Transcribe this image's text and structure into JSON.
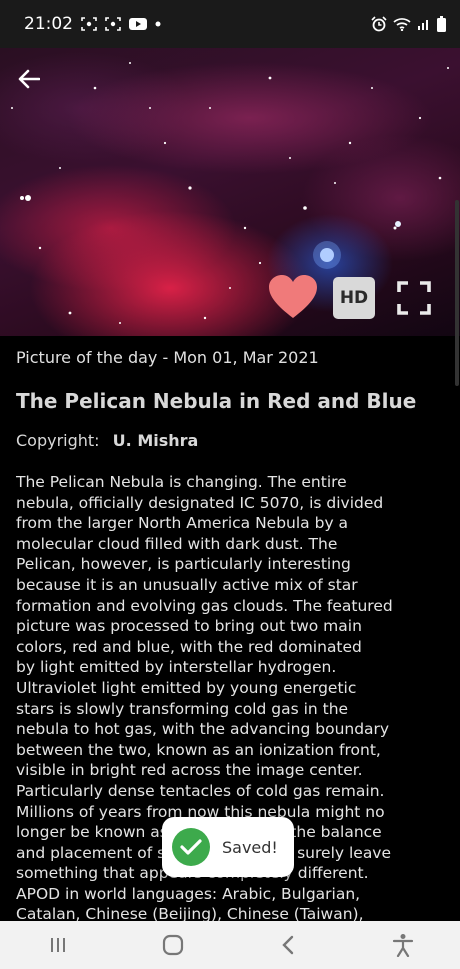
{
  "status_bar": {
    "time": "21:02",
    "notification_icons": [
      "screenshot-icon",
      "screenshot-icon",
      "youtube-icon",
      "dot-icon"
    ],
    "system_icons": [
      "alarm-icon",
      "wifi-icon",
      "signal-icon",
      "battery-icon"
    ]
  },
  "header": {
    "back_icon": "back-arrow-icon"
  },
  "image_actions": {
    "favorite_icon": "heart-icon",
    "favorite_color": "#f07a7a",
    "hd_label": "HD",
    "fullscreen_icon": "fullscreen-icon"
  },
  "apod": {
    "date_line": "Picture of the day - Mon 01, Mar 2021",
    "title": "The Pelican Nebula in Red and Blue",
    "copyright_label": "Copyright:",
    "copyright_name": "U. Mishra",
    "explanation": "The Pelican Nebula is changing.   The entire\nnebula, officially designated IC 5070, is divided\nfrom the larger North America Nebula by a\nmolecular cloud filled with dark dust.  The\nPelican, however, is particularly interesting\nbecause it is an unusually active mix of star\nformation and evolving gas clouds.  The featured\npicture was processed to bring out two main\ncolors, red and blue, with the red dominated\nby light emitted by interstellar hydrogen.\nUltraviolet light emitted by young energetic\nstars is slowly transforming cold gas in the\nnebula to hot gas, with the advancing boundary\nbetween the two, known as an ionization front,\nvisible in bright red across the image center.\nParticularly dense tentacles of cold gas remain.\nMillions of years from now this nebula might no\nlonger be known as the Pelican, as the balance\nand placement of stars and gas will surely leave\nsomething that appears completely different.\nAPOD in world languages: Arabic, Bulgarian,\nCatalan, Chinese (Beijing), Chinese (Taiwan),"
  },
  "toast": {
    "message": "Saved!",
    "icon": "check-circle-icon",
    "icon_color": "#3daa4c"
  },
  "nav_bar": {
    "recents_icon": "recents-icon",
    "home_icon": "home-icon",
    "back_icon": "nav-back-icon",
    "accessibility_icon": "accessibility-icon"
  }
}
